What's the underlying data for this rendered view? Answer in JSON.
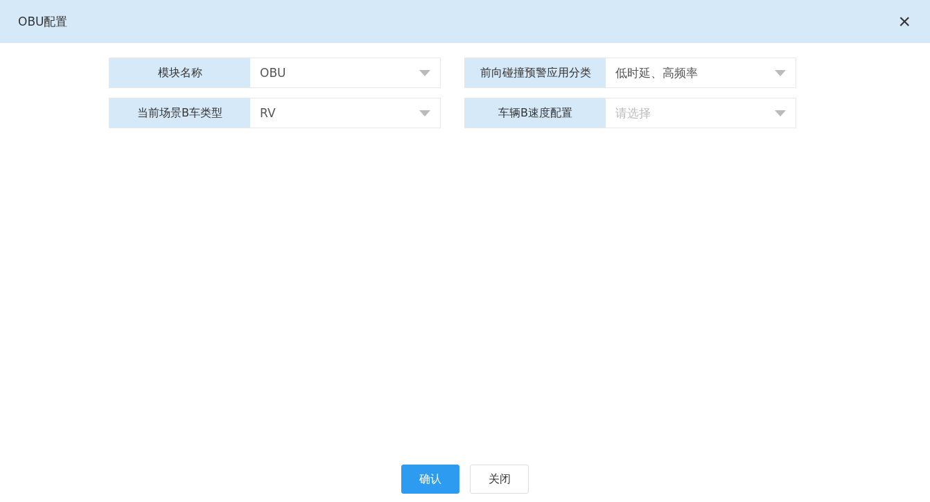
{
  "dialog": {
    "title": "OBU配置",
    "close": "×"
  },
  "fields": [
    {
      "label": "模块名称",
      "value": "OBU"
    },
    {
      "label": "前向碰撞预警应用分类",
      "value": "低时延、高频率"
    },
    {
      "label": "当前场景B车类型",
      "value": "RV"
    },
    {
      "label": "车辆B速度配置",
      "placeholder": "请选择"
    }
  ],
  "buttons": [
    {
      "label": "确认",
      "kind": "primary"
    },
    {
      "label": "关闭",
      "kind": "default"
    }
  ]
}
